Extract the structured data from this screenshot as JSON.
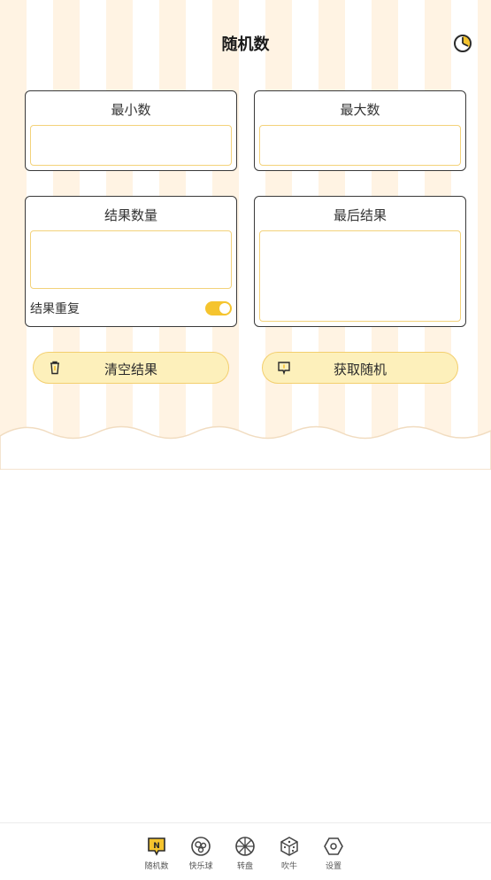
{
  "header": {
    "title": "随机数",
    "history_icon": "clock-icon"
  },
  "cards": {
    "min": {
      "title": "最小数",
      "value": ""
    },
    "max": {
      "title": "最大数",
      "value": ""
    },
    "count": {
      "title": "结果数量",
      "value": ""
    },
    "last": {
      "title": "最后结果",
      "value": ""
    }
  },
  "repeat": {
    "label": "结果重复",
    "enabled": true
  },
  "buttons": {
    "clear": "清空结果",
    "get": "获取随机"
  },
  "tabs": [
    {
      "label": "随机数",
      "icon": "n-badge-icon"
    },
    {
      "label": "快乐球",
      "icon": "balls-icon"
    },
    {
      "label": "转盘",
      "icon": "wheel-icon"
    },
    {
      "label": "吹牛",
      "icon": "dice-icon"
    },
    {
      "label": "设置",
      "icon": "hexagon-icon"
    }
  ],
  "colors": {
    "accent": "#f5c42e",
    "pill_bg": "#fdf0bb",
    "stripe": "#fff3e3"
  }
}
